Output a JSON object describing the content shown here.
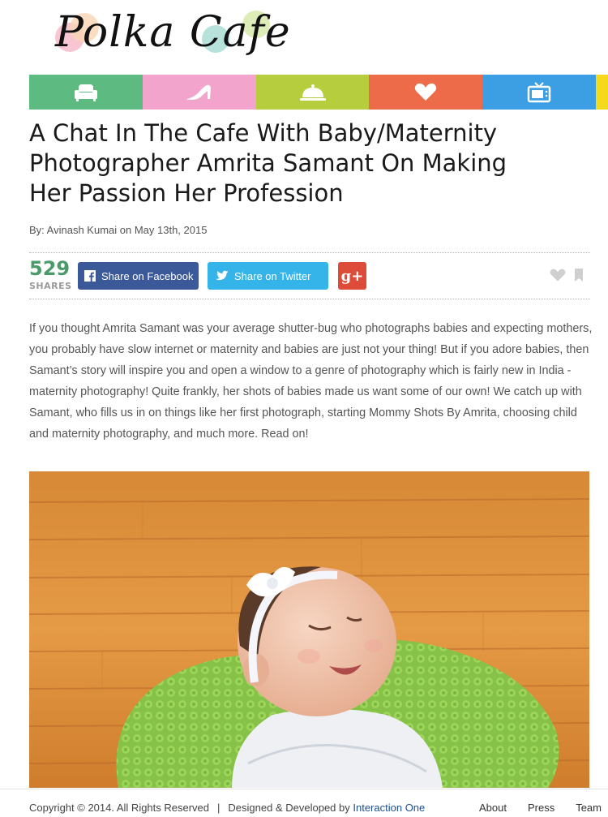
{
  "brand": {
    "logo_text": "Polka Cafe"
  },
  "nav": {
    "categories": [
      {
        "icon": "sofa-icon",
        "color": "#5dba80"
      },
      {
        "icon": "high-heel-icon",
        "color": "#f3a4cc"
      },
      {
        "icon": "cloche-icon",
        "color": "#b6cd3d"
      },
      {
        "icon": "heart-icon",
        "color": "#ee6b49"
      },
      {
        "icon": "tv-icon",
        "color": "#3d9fe3"
      },
      {
        "icon": "",
        "color": "#f5d91c"
      }
    ]
  },
  "article": {
    "title": "A Chat In The Cafe With Baby/Maternity Photographer Amrita Samant On Making Her Passion Her Profession",
    "byline": "By: Avinash Kumai on May 13th, 2015",
    "intro": "If you thought Amrita Samant was your average shutter-bug who photographs babies and expecting mothers, you probably have slow internet or maternity and babies are just not your thing! But if you adore babies, then Samant’s story will inspire you and open a window to a genre of photography which is fairly new in India - maternity photography! Quite frankly, her shots of babies made us want some of our own! We catch up with Samant, who fills us in on things like her first photograph, starting Mommy Shots By Amrita, choosing child and maternity photography, and much more. Read on!"
  },
  "share": {
    "count": "529",
    "count_label": "SHARES",
    "facebook_label": "Share on Facebook",
    "twitter_label": "Share on Twitter",
    "gplus_label": "g+"
  },
  "footer": {
    "copyright": "Copyright © 2014. All Rights Reserved",
    "separator": "|",
    "designed_by": "Designed & Developed by",
    "designer_link": "Interaction One",
    "links": [
      "About",
      "Press",
      "Team"
    ]
  }
}
